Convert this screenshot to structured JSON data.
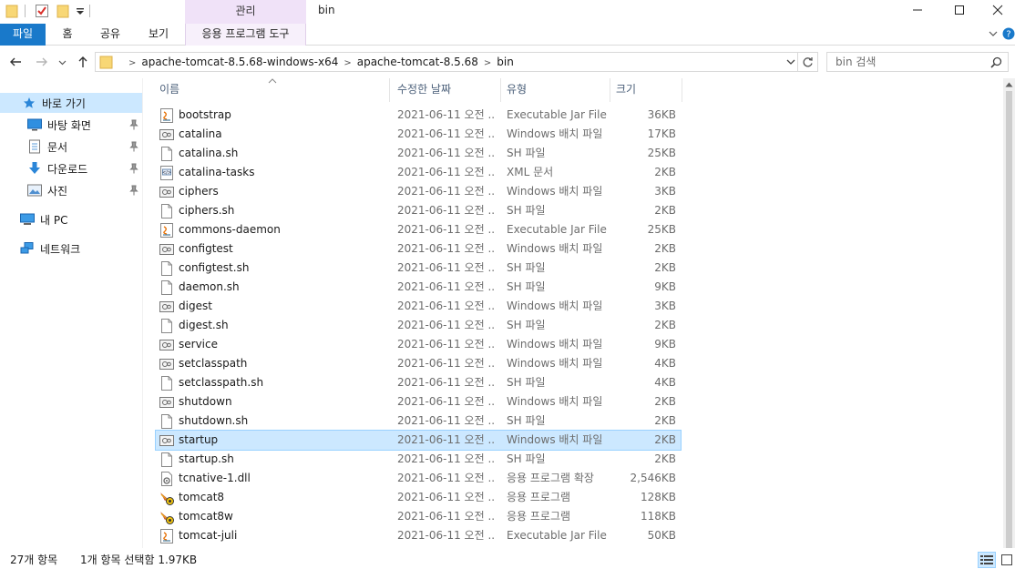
{
  "window": {
    "context_tab_title": "관리",
    "title": "bin"
  },
  "ribbon": {
    "tabs": [
      "파일",
      "홈",
      "공유",
      "보기"
    ],
    "context_tab": "응용 프로그램 도구"
  },
  "address": {
    "breadcrumbs": [
      "apache-tomcat-8.5.68-windows-x64",
      "apache-tomcat-8.5.68",
      "bin"
    ],
    "search_placeholder": "bin 검색"
  },
  "nav": {
    "quick_access": "바로 가기",
    "pinned": [
      {
        "label": "바탕 화면",
        "icon": "desktop-icon"
      },
      {
        "label": "문서",
        "icon": "documents-icon"
      },
      {
        "label": "다운로드",
        "icon": "downloads-icon"
      },
      {
        "label": "사진",
        "icon": "pictures-icon"
      }
    ],
    "this_pc": "내 PC",
    "network": "네트워크"
  },
  "columns": {
    "name": "이름",
    "date": "수정한 날짜",
    "type": "유형",
    "size": "크기"
  },
  "files": [
    {
      "name": "bootstrap",
      "date": "2021-06-11 오전 ...",
      "type": "Executable Jar File",
      "size": "36KB",
      "icon": "jar"
    },
    {
      "name": "catalina",
      "date": "2021-06-11 오전 ...",
      "type": "Windows 배치 파일",
      "size": "17KB",
      "icon": "bat"
    },
    {
      "name": "catalina.sh",
      "date": "2021-06-11 오전 ...",
      "type": "SH 파일",
      "size": "25KB",
      "icon": "file"
    },
    {
      "name": "catalina-tasks",
      "date": "2021-06-11 오전 ...",
      "type": "XML 문서",
      "size": "2KB",
      "icon": "xml"
    },
    {
      "name": "ciphers",
      "date": "2021-06-11 오전 ...",
      "type": "Windows 배치 파일",
      "size": "3KB",
      "icon": "bat"
    },
    {
      "name": "ciphers.sh",
      "date": "2021-06-11 오전 ...",
      "type": "SH 파일",
      "size": "2KB",
      "icon": "file"
    },
    {
      "name": "commons-daemon",
      "date": "2021-06-11 오전 ...",
      "type": "Executable Jar File",
      "size": "25KB",
      "icon": "jar"
    },
    {
      "name": "configtest",
      "date": "2021-06-11 오전 ...",
      "type": "Windows 배치 파일",
      "size": "2KB",
      "icon": "bat"
    },
    {
      "name": "configtest.sh",
      "date": "2021-06-11 오전 ...",
      "type": "SH 파일",
      "size": "2KB",
      "icon": "file"
    },
    {
      "name": "daemon.sh",
      "date": "2021-06-11 오전 ...",
      "type": "SH 파일",
      "size": "9KB",
      "icon": "file"
    },
    {
      "name": "digest",
      "date": "2021-06-11 오전 ...",
      "type": "Windows 배치 파일",
      "size": "3KB",
      "icon": "bat"
    },
    {
      "name": "digest.sh",
      "date": "2021-06-11 오전 ...",
      "type": "SH 파일",
      "size": "2KB",
      "icon": "file"
    },
    {
      "name": "service",
      "date": "2021-06-11 오전 ...",
      "type": "Windows 배치 파일",
      "size": "9KB",
      "icon": "bat"
    },
    {
      "name": "setclasspath",
      "date": "2021-06-11 오전 ...",
      "type": "Windows 배치 파일",
      "size": "4KB",
      "icon": "bat"
    },
    {
      "name": "setclasspath.sh",
      "date": "2021-06-11 오전 ...",
      "type": "SH 파일",
      "size": "4KB",
      "icon": "file"
    },
    {
      "name": "shutdown",
      "date": "2021-06-11 오전 ...",
      "type": "Windows 배치 파일",
      "size": "2KB",
      "icon": "bat"
    },
    {
      "name": "shutdown.sh",
      "date": "2021-06-11 오전 ...",
      "type": "SH 파일",
      "size": "2KB",
      "icon": "file"
    },
    {
      "name": "startup",
      "date": "2021-06-11 오전 ...",
      "type": "Windows 배치 파일",
      "size": "2KB",
      "icon": "bat",
      "selected": true
    },
    {
      "name": "startup.sh",
      "date": "2021-06-11 오전 ...",
      "type": "SH 파일",
      "size": "2KB",
      "icon": "file"
    },
    {
      "name": "tcnative-1.dll",
      "date": "2021-06-11 오전 ...",
      "type": "응용 프로그램 확장",
      "size": "2,546KB",
      "icon": "dll"
    },
    {
      "name": "tomcat8",
      "date": "2021-06-11 오전 ...",
      "type": "응용 프로그램",
      "size": "128KB",
      "icon": "tomcat"
    },
    {
      "name": "tomcat8w",
      "date": "2021-06-11 오전 ...",
      "type": "응용 프로그램",
      "size": "118KB",
      "icon": "tomcat"
    },
    {
      "name": "tomcat-juli",
      "date": "2021-06-11 오전 ...",
      "type": "Executable Jar File",
      "size": "50KB",
      "icon": "jar"
    }
  ],
  "status": {
    "item_count": "27개 항목",
    "selection": "1개 항목 선택함 1.97KB"
  }
}
